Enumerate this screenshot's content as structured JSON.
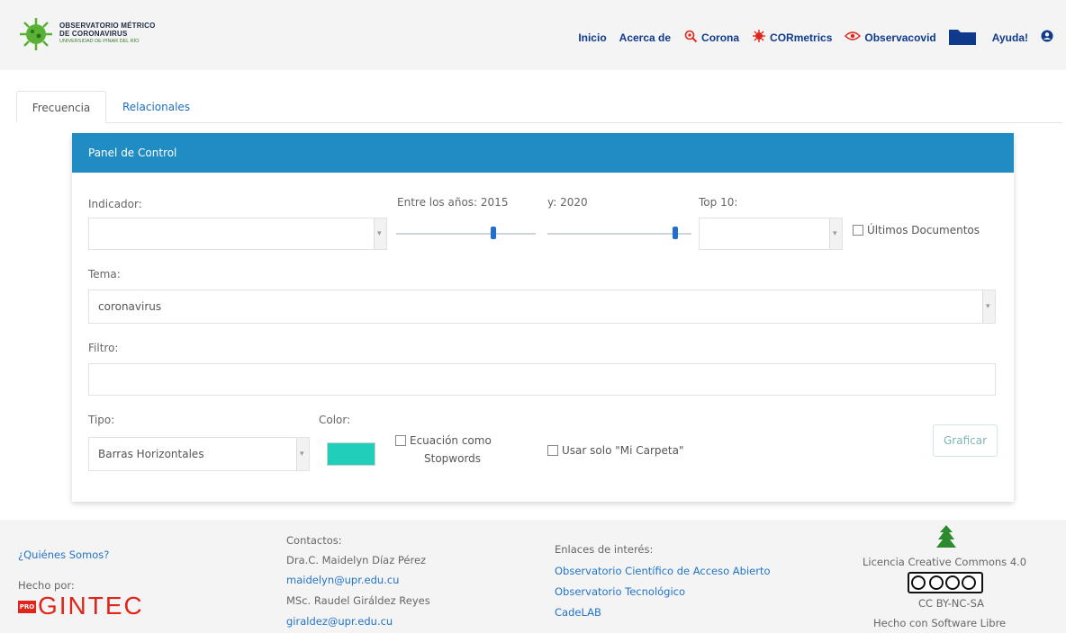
{
  "header": {
    "logo_line1": "OBSERVATORIO MÉTRICO",
    "logo_line2": "DE CORONAVIRUS",
    "logo_line3": "UNIVERSIDAD DE PINAR DEL RÍO",
    "nav": [
      {
        "label": "Inicio",
        "icon": ""
      },
      {
        "label": "Acerca de",
        "icon": ""
      },
      {
        "label": "Corona",
        "icon": "search-virus-icon"
      },
      {
        "label": "CORmetrics",
        "icon": "virus-icon"
      },
      {
        "label": "Observacovid",
        "icon": "eye-icon"
      },
      {
        "label": "",
        "icon": "folder-icon"
      },
      {
        "label": "Ayuda!",
        "icon": ""
      },
      {
        "label": "",
        "icon": "user-icon"
      }
    ]
  },
  "tabs": {
    "frecuencia": "Frecuencia",
    "relacionales": "Relacionales"
  },
  "panel": {
    "title": "Panel de Control",
    "indicador_label": "Indicador:",
    "indicador_value": "",
    "years_label_from": "Entre los años: 2015",
    "years_label_to": "y: 2020",
    "slider_from": 2015,
    "slider_to": 2020,
    "top_label": "Top 10:",
    "top_value": "",
    "ultimos_label": "Últimos Documentos",
    "tema_label": "Tema:",
    "tema_value": "coronavirus",
    "filtro_label": "Filtro:",
    "filtro_value": "",
    "tipo_label": "Tipo:",
    "tipo_value": "Barras Horizontales",
    "color_label": "Color:",
    "color_value": "#1fcfb9",
    "ecuacion_line1": "Ecuación como",
    "ecuacion_line2": "Stopwords",
    "carpeta_label": "Usar solo \"Mi Carpeta\"",
    "graficar_label": "Graficar",
    "header_color": "#1f8cc4"
  },
  "footer": {
    "quienes": "¿Quiénes Somos?",
    "hecho_por": "Hecho por:",
    "gintec_tag": "PRO",
    "gintec": "GINTEC",
    "contactos": "Contactos:",
    "contact1_name": "Dra.C. Maidelyn Díaz Pérez",
    "contact1_email": "maidelyn@upr.edu.cu",
    "contact2_name": "MSc. Raudel Giráldez Reyes",
    "contact2_email": "giraldez@upr.edu.cu",
    "enlaces": "Enlaces de interés:",
    "link1": "Observatorio Científico de Acceso Abierto",
    "link2": "Observatorio Tecnológico",
    "link3": "CadeLAB",
    "licencia": "Licencia Creative Commons 4.0",
    "cc": "CC BY-NC-SA",
    "software": "Hecho con Software Libre"
  }
}
